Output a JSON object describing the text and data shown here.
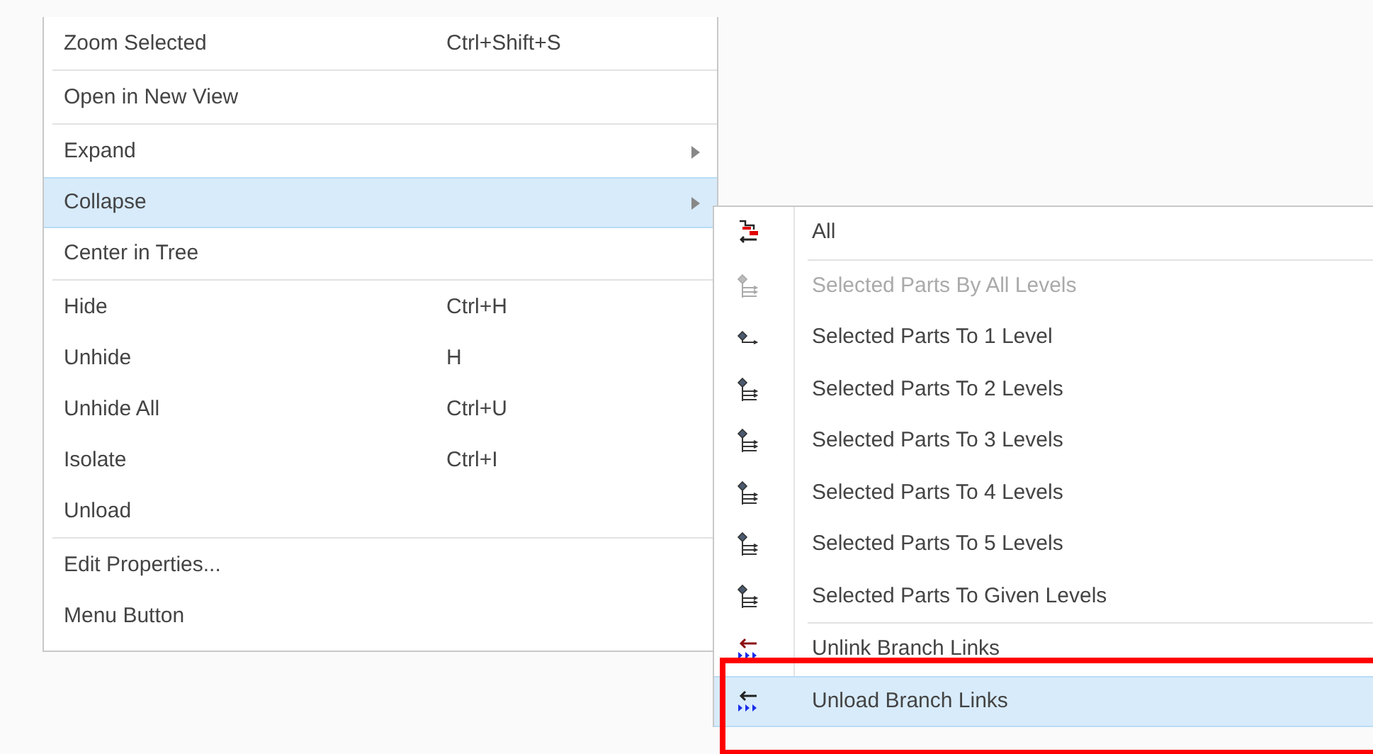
{
  "menu": {
    "groups": [
      {
        "items": [
          {
            "label": "Zoom Selected",
            "shortcut": "Ctrl+Shift+S",
            "submenu": false,
            "selected": false
          }
        ]
      },
      {
        "items": [
          {
            "label": "Open in New View",
            "submenu": false,
            "selected": false
          }
        ]
      },
      {
        "items": [
          {
            "label": "Expand",
            "submenu": true,
            "selected": false
          },
          {
            "label": "Collapse",
            "submenu": true,
            "selected": true
          },
          {
            "label": "Center in Tree",
            "submenu": false,
            "selected": false
          }
        ]
      },
      {
        "items": [
          {
            "label": "Hide",
            "shortcut": "Ctrl+H",
            "submenu": false,
            "selected": false
          },
          {
            "label": "Unhide",
            "shortcut": "H",
            "submenu": false,
            "selected": false
          },
          {
            "label": "Unhide All",
            "shortcut": "Ctrl+U",
            "submenu": false,
            "selected": false
          },
          {
            "label": "Isolate",
            "shortcut": "Ctrl+I",
            "submenu": false,
            "selected": false
          },
          {
            "label": "Unload",
            "submenu": false,
            "selected": false
          }
        ]
      },
      {
        "items": [
          {
            "label": "Edit Properties...",
            "submenu": false,
            "selected": false
          },
          {
            "label": "Menu Button",
            "submenu": false,
            "selected": false
          }
        ]
      }
    ]
  },
  "submenu": {
    "groups": [
      {
        "items": [
          {
            "label": "All",
            "kind": "collapse-all",
            "disabled": false,
            "selected": false,
            "annotated": false
          }
        ]
      },
      {
        "items": [
          {
            "label": "Selected Parts By All Levels",
            "kind": "levels",
            "disabled": true,
            "selected": false,
            "annotated": false
          },
          {
            "label": "Selected Parts To 1 Level",
            "kind": "one-level",
            "disabled": false,
            "selected": false,
            "annotated": false
          },
          {
            "label": "Selected Parts To 2 Levels",
            "kind": "levels",
            "disabled": false,
            "selected": false,
            "annotated": false
          },
          {
            "label": "Selected Parts To 3 Levels",
            "kind": "levels",
            "disabled": false,
            "selected": false,
            "annotated": false
          },
          {
            "label": "Selected Parts To 4 Levels",
            "kind": "levels",
            "disabled": false,
            "selected": false,
            "annotated": false
          },
          {
            "label": "Selected Parts To 5 Levels",
            "kind": "levels",
            "disabled": false,
            "selected": false,
            "annotated": false
          },
          {
            "label": "Selected Parts To Given Levels",
            "kind": "levels",
            "disabled": false,
            "selected": false,
            "annotated": false
          }
        ]
      },
      {
        "items": [
          {
            "label": "Unlink Branch Links",
            "kind": "unlink",
            "disabled": false,
            "selected": false,
            "annotated": false
          },
          {
            "label": "Unload Branch Links",
            "kind": "unload",
            "disabled": false,
            "selected": true,
            "annotated": true
          }
        ]
      }
    ]
  }
}
